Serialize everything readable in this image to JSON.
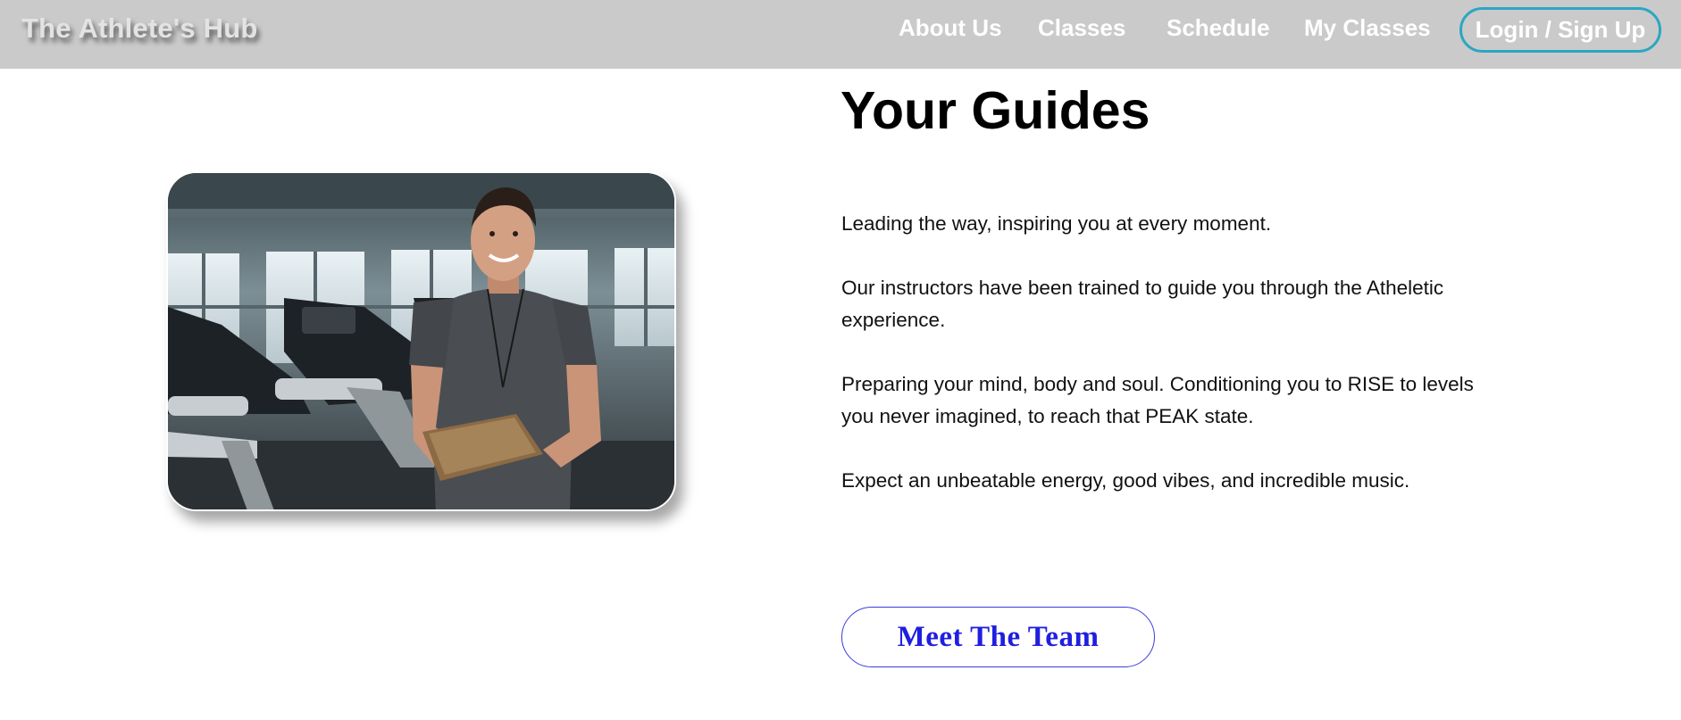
{
  "header": {
    "brand": "The Athlete's Hub",
    "nav": {
      "about": "About Us",
      "classes": "Classes",
      "schedule": "Schedule",
      "my_classes": "My Classes",
      "login": "Login / Sign Up"
    }
  },
  "main": {
    "title": "Your Guides",
    "paragraphs": [
      "Leading the way, inspiring you at every moment.",
      "Our instructors have been trained to guide you through the Atheletic experience.",
      "Preparing your mind, body and soul. Conditioning you to RISE to levels you never imagined, to reach that PEAK state.",
      "Expect an unbeatable energy, good vibes, and incredible music."
    ],
    "cta": "Meet The Team"
  },
  "colors": {
    "nav_background": "#cacaca",
    "login_border": "#2aa7c2",
    "cta_color": "#1f1fe0"
  }
}
